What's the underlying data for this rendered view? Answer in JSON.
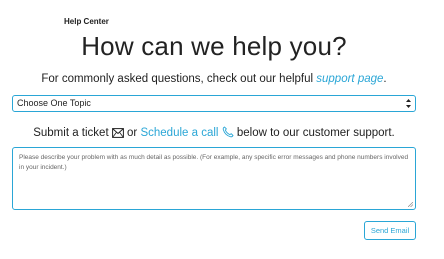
{
  "header": {
    "small_title": "Help Center",
    "main_title": "How can we help you?"
  },
  "intro": {
    "text_before": "For commonly asked questions, check out our helpful ",
    "link_text": "support page",
    "text_after": "."
  },
  "topic_select": {
    "selected": "Choose One Topic"
  },
  "ticket": {
    "text_before": "Submit a ticket",
    "mail_icon": "envelope-icon",
    "text_or": " or ",
    "schedule_link": "Schedule a call",
    "phone_icon": "phone-icon",
    "text_after": " below to our customer support."
  },
  "message": {
    "placeholder": "Please describe your problem with as much detail as possible. (For example, any specific error messages and phone numbers involved in your incident.)"
  },
  "actions": {
    "send_label": "Send Email"
  },
  "colors": {
    "accent": "#2aa6d6",
    "text": "#222222"
  }
}
